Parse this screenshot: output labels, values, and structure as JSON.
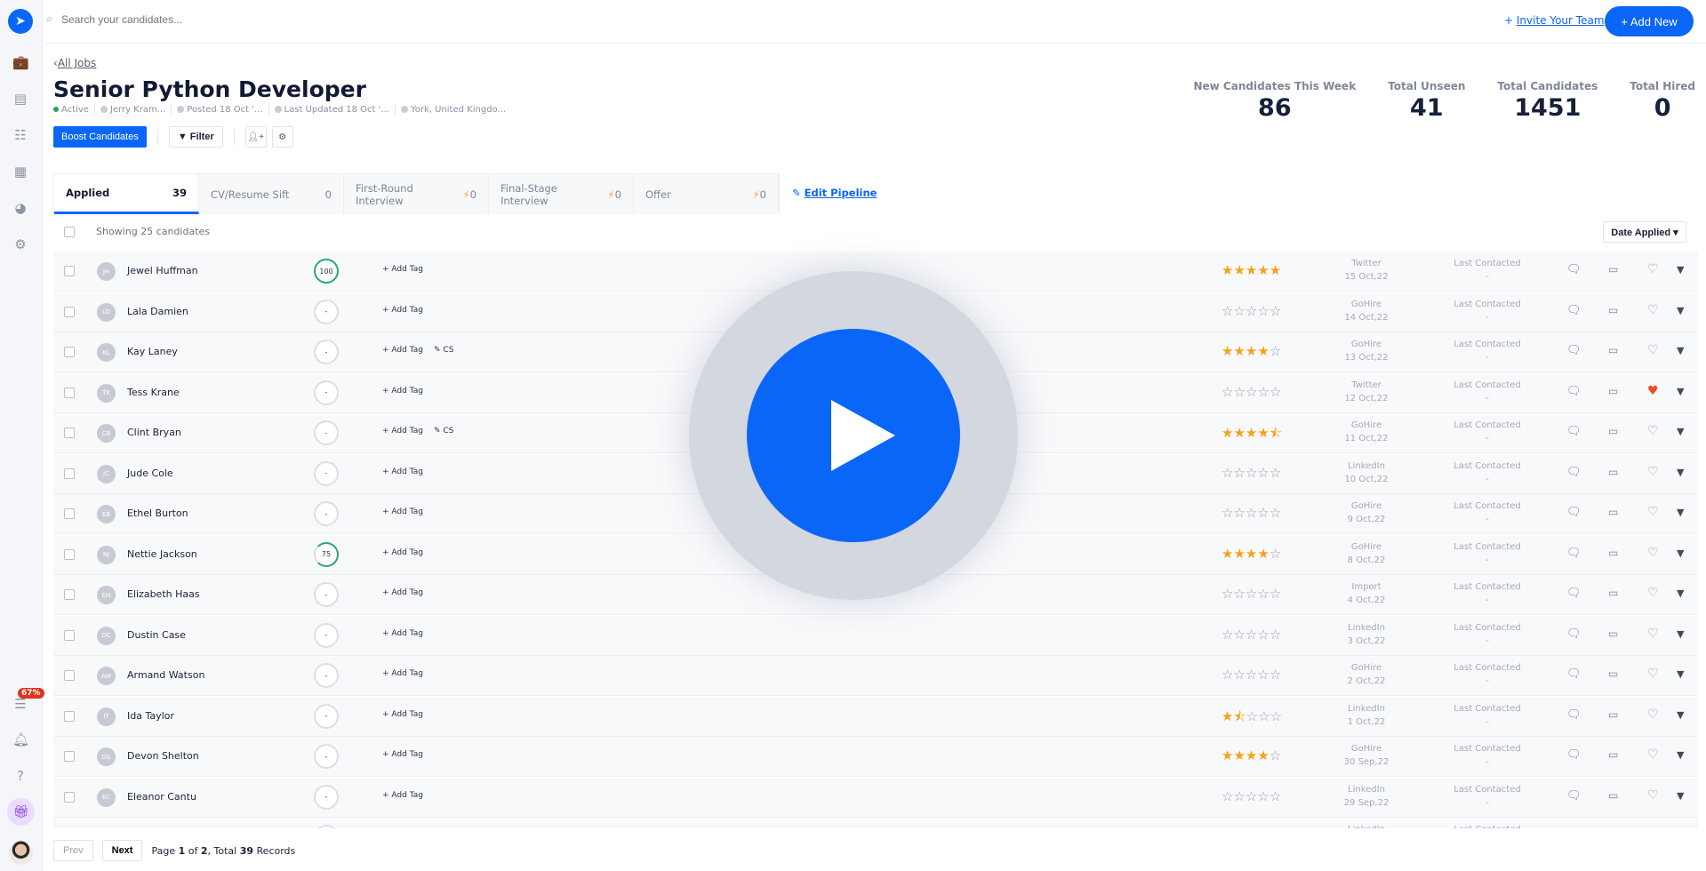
{
  "search": {
    "placeholder": "Search your candidates..."
  },
  "topbar": {
    "invite_label": "Invite Your Team",
    "add_new_label": "+ Add New"
  },
  "sidebar": {
    "badge": "67%"
  },
  "job": {
    "back_label": "All Jobs",
    "title": "Senior Python Developer",
    "meta": {
      "status": "Active",
      "owner": "Jerry Kram...",
      "posted": "Posted 18 Oct '...",
      "updated": "Last Updated 18 Oct '...",
      "location": "York, United Kingdo..."
    }
  },
  "actions": {
    "boost": "Boost Candidates",
    "filter": "Filter"
  },
  "stats": [
    {
      "label": "New Candidates This Week",
      "value": "86"
    },
    {
      "label": "Total Unseen",
      "value": "41"
    },
    {
      "label": "Total Candidates",
      "value": "1451"
    },
    {
      "label": "Total Hired",
      "value": "0"
    }
  ],
  "tabs": [
    {
      "label": "Applied",
      "count": "39",
      "bolt": false
    },
    {
      "label": "CV/Resume Sift",
      "count": "0",
      "bolt": false
    },
    {
      "label": "First-Round Interview",
      "count": "0",
      "bolt": true
    },
    {
      "label": "Final-Stage Interview",
      "count": "0",
      "bolt": true
    },
    {
      "label": "Offer",
      "count": "0",
      "bolt": true
    }
  ],
  "edit_pipeline": "Edit Pipeline",
  "list": {
    "showing": "Showing 25 candidates",
    "sort": "Date Applied",
    "add_tag": "+ Add Tag",
    "last_contacted": "Last Contacted",
    "last_contacted_value": "-"
  },
  "candidates": [
    {
      "initials": "JH",
      "name": "Jewel Huffman",
      "score": "100",
      "rating": 5,
      "source": "Twitter",
      "date": "15 Oct,22",
      "tag": "",
      "fav": false
    },
    {
      "initials": "LD",
      "name": "Lala Damien",
      "score": "-",
      "rating": 0,
      "source": "GoHire",
      "date": "14 Oct,22",
      "tag": "",
      "fav": false
    },
    {
      "initials": "KL",
      "name": "Kay Laney",
      "score": "-",
      "rating": 4,
      "source": "GoHire",
      "date": "13 Oct,22",
      "tag": "CS",
      "fav": false
    },
    {
      "initials": "TK",
      "name": "Tess Krane",
      "score": "-",
      "rating": 0,
      "source": "Twitter",
      "date": "12 Oct,22",
      "tag": "",
      "fav": true
    },
    {
      "initials": "CB",
      "name": "Clint Bryan",
      "score": "-",
      "rating": 4.5,
      "source": "GoHire",
      "date": "11 Oct,22",
      "tag": "CS",
      "fav": false
    },
    {
      "initials": "JC",
      "name": "Jude Cole",
      "score": "-",
      "rating": 0,
      "source": "LinkedIn",
      "date": "10 Oct,22",
      "tag": "",
      "fav": false
    },
    {
      "initials": "EB",
      "name": "Ethel Burton",
      "score": "-",
      "rating": 0,
      "source": "GoHire",
      "date": "9 Oct,22",
      "tag": "",
      "fav": false
    },
    {
      "initials": "NJ",
      "name": "Nettie Jackson",
      "score": "75",
      "rating": 4,
      "source": "GoHire",
      "date": "8 Oct,22",
      "tag": "",
      "fav": false
    },
    {
      "initials": "EH",
      "name": "Elizabeth Haas",
      "score": "-",
      "rating": 0,
      "source": "Import",
      "date": "4 Oct,22",
      "tag": "",
      "fav": false
    },
    {
      "initials": "DC",
      "name": "Dustin Case",
      "score": "-",
      "rating": 0,
      "source": "LinkedIn",
      "date": "3 Oct,22",
      "tag": "",
      "fav": false
    },
    {
      "initials": "AW",
      "name": "Armand Watson",
      "score": "-",
      "rating": 0,
      "source": "GoHire",
      "date": "2 Oct,22",
      "tag": "",
      "fav": false
    },
    {
      "initials": "IT",
      "name": "Ida Taylor",
      "score": "-",
      "rating": 1.5,
      "source": "LinkedIn",
      "date": "1 Oct,22",
      "tag": "",
      "fav": false
    },
    {
      "initials": "DS",
      "name": "Devon Shelton",
      "score": "-",
      "rating": 4,
      "source": "GoHire",
      "date": "30 Sep,22",
      "tag": "",
      "fav": false
    },
    {
      "initials": "EC",
      "name": "Eleanor Cantu",
      "score": "-",
      "rating": 0,
      "source": "LinkedIn",
      "date": "29 Sep,22",
      "tag": "",
      "fav": false
    },
    {
      "initials": "",
      "name": "",
      "score": "-",
      "rating": 0,
      "source": "LinkedIn",
      "date": "",
      "tag": "",
      "fav": false
    }
  ],
  "pagination": {
    "prev": "Prev",
    "next": "Next",
    "page_prefix": "Page ",
    "page": "1",
    "of": " of ",
    "pages": "2",
    "total_prefix": ", Total ",
    "total": "39",
    "total_suffix": " Records"
  },
  "colors": {
    "accent": "#0a66f6",
    "star": "#f5a21a",
    "favorite": "#ef4a26",
    "score_full": "#2aa86a",
    "badge": "#e0331f"
  }
}
